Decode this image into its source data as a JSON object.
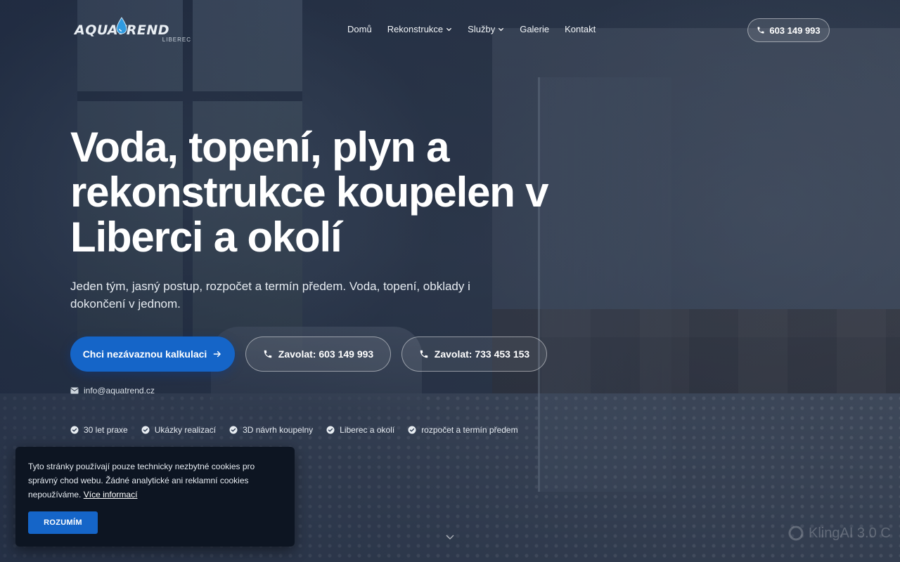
{
  "brand": {
    "logo_text": "AQUATREND",
    "logo_subtext": "LIBEREC"
  },
  "nav": {
    "items": [
      {
        "label": "Domů",
        "has_dropdown": false
      },
      {
        "label": "Rekonstrukce",
        "has_dropdown": true
      },
      {
        "label": "Služby",
        "has_dropdown": true
      },
      {
        "label": "Galerie",
        "has_dropdown": false
      },
      {
        "label": "Kontakt",
        "has_dropdown": false
      }
    ],
    "phone": "603 149 993"
  },
  "hero": {
    "title": "Voda, topení, plyn a rekonstrukce koupelen v Liberci a okolí",
    "subtitle": "Jeden tým, jasný postup, rozpočet a termín předem. Voda, topení, obklady i dokončení v jednom.",
    "cta_primary": "Chci nezávaznou kalkulaci",
    "cta_call_1": "Zavolat: 603 149 993",
    "cta_call_2": "Zavolat: 733 453 153",
    "email": "info@aquatrend.cz",
    "features": [
      "30 let praxe",
      "Ukázky realizací",
      "3D návrh koupelny",
      "Liberec a okolí",
      "rozpočet a termín předem"
    ]
  },
  "cookie": {
    "text": "Tyto stránky používají pouze technicky nezbytné cookies pro správný chod webu. Žádné analytické ani reklamní cookies nepoužíváme.",
    "link": "Více informací",
    "button": "ROZUMÍM"
  },
  "watermark": "KlingAI 3.0 C",
  "colors": {
    "accent": "#1565c8",
    "overlay": "#16223a",
    "cookie_bg": "#0d1522"
  }
}
